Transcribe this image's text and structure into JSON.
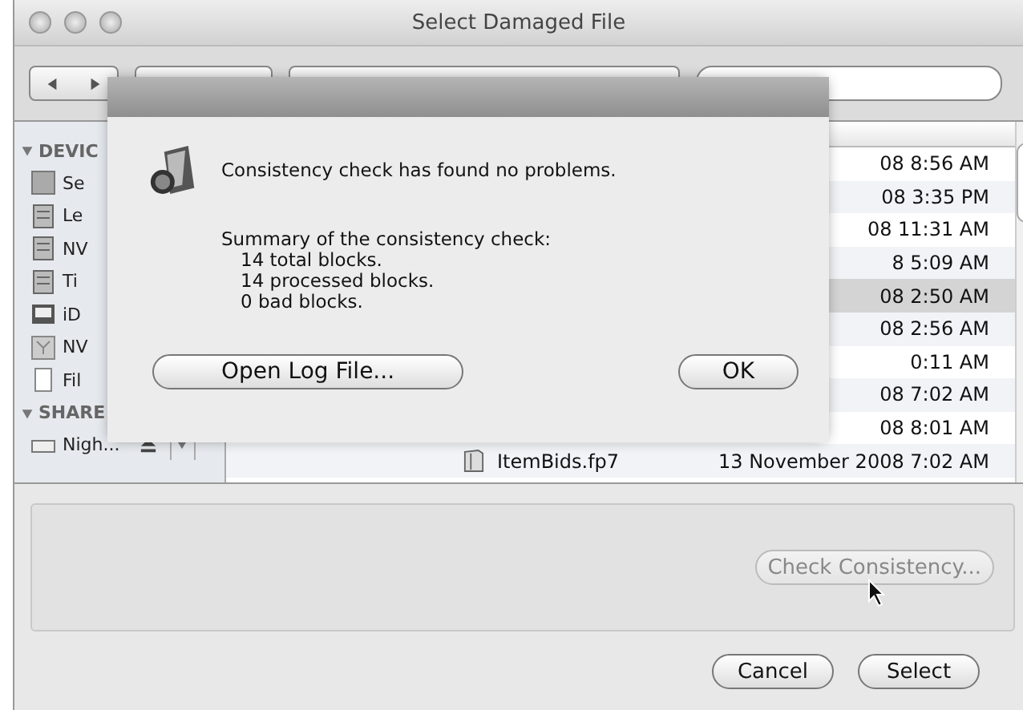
{
  "window": {
    "title": "Select Damaged File"
  },
  "sidebar": {
    "sections": [
      {
        "label": "DEVIC",
        "expanded": true,
        "items": [
          {
            "label": "Se",
            "kind": "volume"
          },
          {
            "label": "Le",
            "kind": "drive"
          },
          {
            "label": "NV",
            "kind": "drive"
          },
          {
            "label": "Ti",
            "kind": "drive"
          },
          {
            "label": "iD",
            "kind": "display"
          },
          {
            "label": "NV",
            "kind": "image"
          },
          {
            "label": "Fil",
            "kind": "document"
          }
        ]
      },
      {
        "label": "SHARE",
        "expanded": true,
        "items": [
          {
            "label": "Nigh...",
            "kind": "server"
          }
        ]
      }
    ]
  },
  "file_list": {
    "rows": [
      {
        "date": "08 8:56 AM",
        "selected": false
      },
      {
        "date": "08 3:35 PM",
        "selected": false
      },
      {
        "date": "08 11:31 AM",
        "selected": false
      },
      {
        "date": "8 5:09 AM",
        "selected": false
      },
      {
        "date": "08 2:50 AM",
        "selected": true
      },
      {
        "date": "08 2:56 AM",
        "selected": false
      },
      {
        "date": "0:11 AM",
        "selected": false
      },
      {
        "date": "08 7:02 AM",
        "selected": false
      },
      {
        "date": "08 8:01 AM",
        "selected": false
      },
      {
        "name": "ItemBids.fp7",
        "date": "13 November 2008 7:02 AM",
        "selected": false
      }
    ]
  },
  "dialog": {
    "message": "Consistency check has found no problems.",
    "summary_title": "Summary of the consistency check:",
    "summary_lines": [
      "14 total blocks.",
      "14 processed blocks.",
      "0 bad blocks."
    ],
    "buttons": [
      "Open Log File...",
      "OK"
    ]
  },
  "check_button": {
    "label": "Check Consistency...",
    "disabled": true
  },
  "buttons": [
    "Cancel",
    "Select"
  ]
}
